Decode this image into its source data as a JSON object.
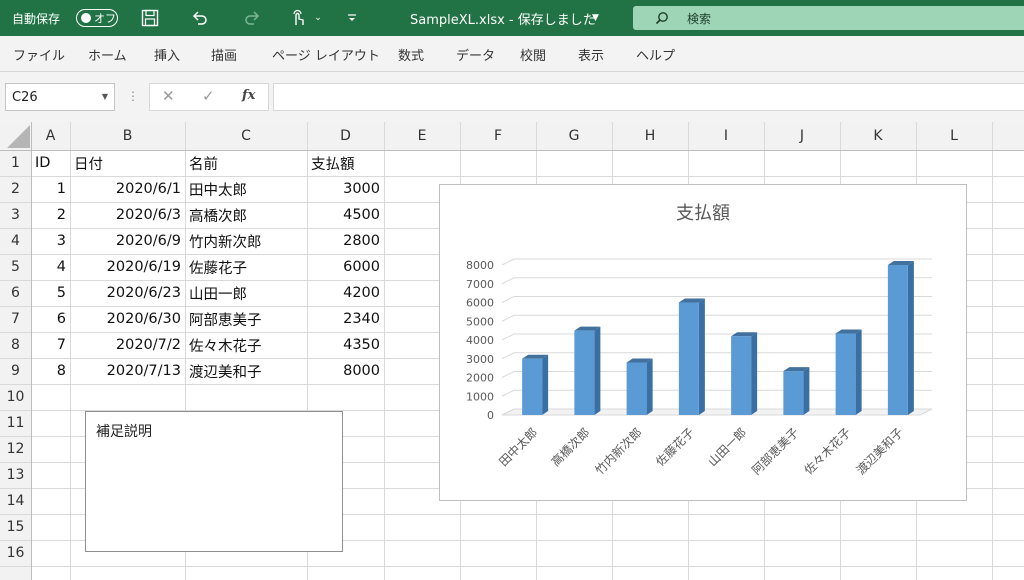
{
  "titlebar": {
    "autosave_label": "自動保存",
    "autosave_state": "オフ",
    "title": "SampleXL.xlsx - 保存しました",
    "search_label": "検索"
  },
  "ribbon": {
    "tabs": [
      "ファイル",
      "ホーム",
      "挿入",
      "描画",
      "ページ レイアウト",
      "数式",
      "データ",
      "校閲",
      "表示",
      "ヘルプ"
    ]
  },
  "formula_bar": {
    "name_box": "C26",
    "formula": ""
  },
  "sheet": {
    "columns": [
      "A",
      "B",
      "C",
      "D",
      "E",
      "F",
      "G",
      "H",
      "I",
      "J",
      "K",
      "L"
    ],
    "rows": [
      "1",
      "2",
      "3",
      "4",
      "5",
      "6",
      "7",
      "8",
      "9",
      "10",
      "11",
      "12",
      "13",
      "14",
      "15",
      "16"
    ],
    "header": [
      "ID",
      "日付",
      "名前",
      "支払額"
    ],
    "data": [
      [
        "1",
        "2020/6/1",
        "田中太郎",
        "3000"
      ],
      [
        "2",
        "2020/6/3",
        "高橋次郎",
        "4500"
      ],
      [
        "3",
        "2020/6/9",
        "竹内新次郎",
        "2800"
      ],
      [
        "4",
        "2020/6/19",
        "佐藤花子",
        "6000"
      ],
      [
        "5",
        "2020/6/23",
        "山田一郎",
        "4200"
      ],
      [
        "6",
        "2020/6/30",
        "阿部恵美子",
        "2340"
      ],
      [
        "7",
        "2020/7/2",
        "佐々木花子",
        "4350"
      ],
      [
        "8",
        "2020/7/13",
        "渡辺美和子",
        "8000"
      ]
    ]
  },
  "textbox": {
    "text": "補足説明"
  },
  "colors": {
    "titlebar": "#217346",
    "bar_front": "#5b9bd5",
    "bar_side": "#3a6fa3",
    "bar_top": "#41719c"
  },
  "chart_data": {
    "type": "bar",
    "title": "支払額",
    "categories": [
      "田中太郎",
      "高橋次郎",
      "竹内新次郎",
      "佐藤花子",
      "山田一郎",
      "阿部恵美子",
      "佐々木花子",
      "渡辺美和子"
    ],
    "values": [
      3000,
      4500,
      2800,
      6000,
      4200,
      2340,
      4350,
      8000
    ],
    "yticks": [
      0,
      1000,
      2000,
      3000,
      4000,
      5000,
      6000,
      7000,
      8000
    ],
    "ylim": [
      0,
      8000
    ],
    "grid": true,
    "style": "3d-column"
  }
}
